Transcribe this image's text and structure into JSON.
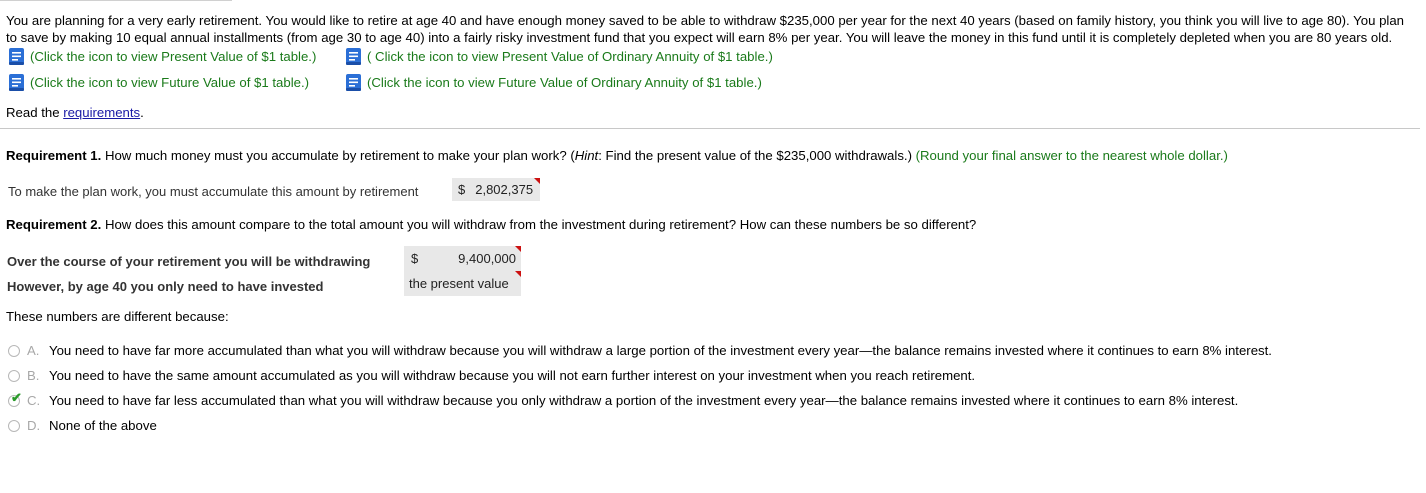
{
  "problem_text": "You are planning for a very early retirement. You would like to retire at age 40 and have enough money saved to be able to withdraw $235,000 per year for the next 40 years (based on family history, you think you will live to age 80). You plan to save by making 10 equal annual installments (from age 30 to age 40) into a fairly risky investment fund that you expect will earn 8% per year. You will leave the money in this fund until it is completely depleted when you are 80 years old.",
  "links": {
    "pv1": "(Click the icon to view Present Value of $1 table.)",
    "pvoa": "( Click the icon to view Present Value of Ordinary Annuity of $1 table.)",
    "fv1": "(Click the icon to view Future Value of $1 table.)",
    "fvoa": "(Click the icon to view Future Value of Ordinary Annuity of $1 table.)"
  },
  "read": {
    "prefix": "Read the ",
    "link": "requirements",
    "suffix": "."
  },
  "req1": {
    "label": "Requirement 1.",
    "text_a": " How much money must you accumulate by retirement to make your plan work? (",
    "hint": "Hint",
    "text_b": ": Find the present value of the $235,000 withdrawals.) ",
    "instruction": "(Round your final answer to the nearest whole dollar.)",
    "answer_label": "To make the plan work, you must accumulate this amount by retirement",
    "currency": "$",
    "answer_value": "2,802,375"
  },
  "req2": {
    "label": "Requirement 2.",
    "text": " How does this amount compare to the total amount you will withdraw from the investment during retirement? How can these numbers be so different?",
    "row1_label": "Over the course of your retirement you will be withdrawing",
    "row1_currency": "$",
    "row1_value": "9,400,000",
    "row2_label": "However, by age 40 you only need to have invested",
    "row2_value": "the present value",
    "because": "These numbers are different because:"
  },
  "options": [
    {
      "letter": "A.",
      "text": "You need to have far more accumulated than what you will withdraw because you will withdraw a large portion of the investment every year—the balance remains invested where it continues to earn 8% interest."
    },
    {
      "letter": "B.",
      "text": "You need to have the same amount accumulated as you will withdraw because you will not earn further interest on your investment when you reach retirement."
    },
    {
      "letter": "C.",
      "text": "You need to have far less accumulated than what you will withdraw because you only withdraw a portion of the investment every year—the balance remains invested where it continues to earn 8% interest."
    },
    {
      "letter": "D.",
      "text": "None of the above"
    }
  ],
  "selected_option": "C.",
  "colors": {
    "link_green": "#1a7a1a",
    "book_blue": "#2b6fd6",
    "answer_bg": "#e8e8e8",
    "flag_red": "#cc1111",
    "check_green": "#2a9a2a"
  }
}
